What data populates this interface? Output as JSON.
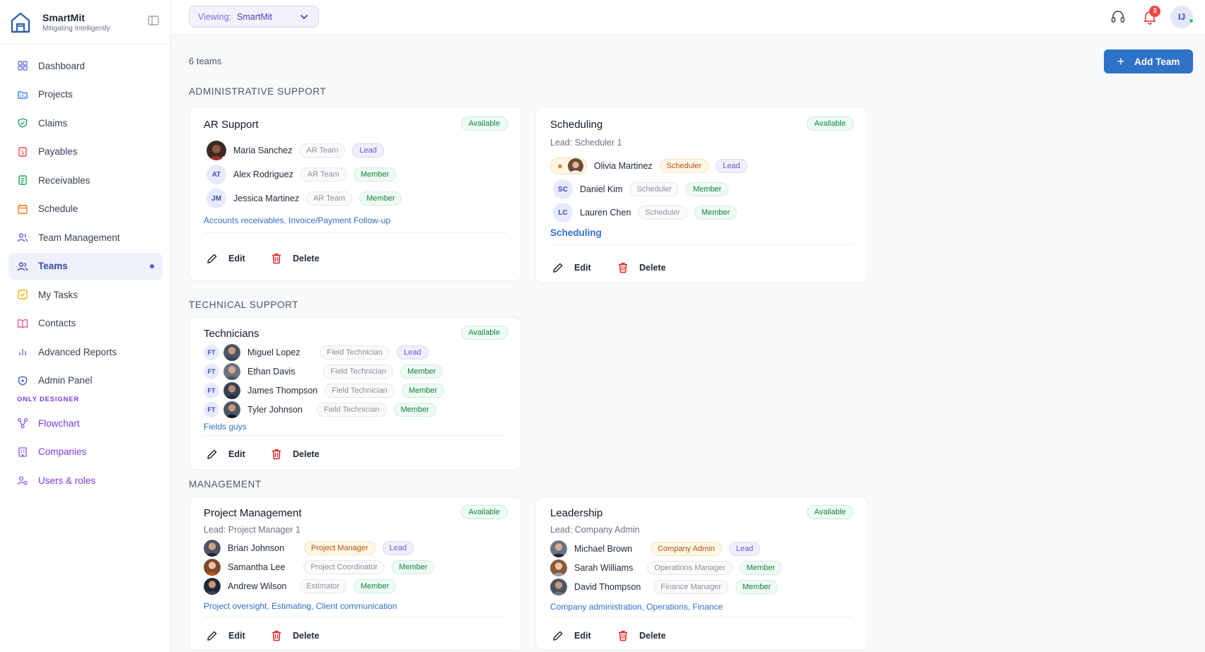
{
  "brand": {
    "name": "SmartMit",
    "tagline": "Mitigating Intelligently"
  },
  "sidebar": {
    "items": [
      {
        "label": "Dashboard",
        "icon": "grid-icon"
      },
      {
        "label": "Projects",
        "icon": "folder-icon"
      },
      {
        "label": "Claims",
        "icon": "shield-check-icon"
      },
      {
        "label": "Payables",
        "icon": "dollar-doc-icon"
      },
      {
        "label": "Receivables",
        "icon": "receipt-icon"
      },
      {
        "label": "Schedule",
        "icon": "calendar-icon"
      },
      {
        "label": "Team Management",
        "icon": "users-icon"
      },
      {
        "label": "Teams",
        "icon": "users-icon",
        "active": true
      },
      {
        "label": "My Tasks",
        "icon": "checkbox-icon"
      },
      {
        "label": "Contacts",
        "icon": "book-icon"
      },
      {
        "label": "Advanced Reports",
        "icon": "bar-chart-icon"
      },
      {
        "label": "Admin Panel",
        "icon": "shield-icon"
      }
    ],
    "designer_section": "ONLY DESIGNER",
    "designer_items": [
      {
        "label": "Flowchart",
        "icon": "flowchart-icon"
      },
      {
        "label": "Companies",
        "icon": "building-icon"
      },
      {
        "label": "Users & roles",
        "icon": "user-roles-icon"
      }
    ]
  },
  "topbar": {
    "viewing_label": "Viewing:",
    "viewing_value": "SmartMit",
    "notification_count": "3",
    "user_initials": "IJ"
  },
  "main": {
    "teams_count": "6 teams",
    "add_team_label": "Add Team",
    "edit_label": "Edit",
    "delete_label": "Delete",
    "sections": [
      {
        "title": "ADMINISTRATIVE SUPPORT",
        "cards": [
          {
            "name": "AR Support",
            "status": "Available",
            "lead": "",
            "members": [
              {
                "name": "Maria Sanchez",
                "role": "AR Team",
                "membership": "Lead",
                "avatar": "photo"
              },
              {
                "name": "Alex Rodriguez",
                "role": "AR Team",
                "membership": "Member",
                "avatar": "AT"
              },
              {
                "name": "Jessica Martinez",
                "role": "AR Team",
                "membership": "Member",
                "avatar": "JM"
              }
            ],
            "tags": "Accounts receivables, Invoice/Payment Follow-up"
          },
          {
            "name": "Scheduling",
            "status": "Available",
            "lead": "Lead: Scheduler 1",
            "members": [
              {
                "name": "Olivia Martinez",
                "role": "Scheduler",
                "membership": "Lead",
                "avatar": "photo"
              },
              {
                "name": "Daniel Kim",
                "role": "Scheduler",
                "membership": "Member",
                "avatar": "SC"
              },
              {
                "name": "Lauren Chen",
                "role": "Scheduler",
                "membership": "Member",
                "avatar": "LC"
              }
            ],
            "tags": "Scheduling"
          }
        ]
      },
      {
        "title": "TECHNICAL SUPPORT",
        "cards": [
          {
            "name": "Technicians",
            "status": "Available",
            "lead": "",
            "members": [
              {
                "name": "Miguel Lopez",
                "role": "Field Technician",
                "membership": "Lead",
                "avatar": "FT"
              },
              {
                "name": "Ethan Davis",
                "role": "Field Technician",
                "membership": "Member",
                "avatar": "FT"
              },
              {
                "name": "James Thompson",
                "role": "Field Technician",
                "membership": "Member",
                "avatar": "FT"
              },
              {
                "name": "Tyler Johnson",
                "role": "Field Technician",
                "membership": "Member",
                "avatar": "FT"
              }
            ],
            "tags": "Fields guys"
          }
        ]
      },
      {
        "title": "MANAGEMENT",
        "cards": [
          {
            "name": "Project Management",
            "status": "Available",
            "lead": "Lead: Project Manager 1",
            "members": [
              {
                "name": "Brian Johnson",
                "role": "Project Manager",
                "membership": "Lead",
                "avatar": "photo"
              },
              {
                "name": "Samantha Lee",
                "role": "Project Coordinator",
                "membership": "Member",
                "avatar": "photo"
              },
              {
                "name": "Andrew Wilson",
                "role": "Estimator",
                "membership": "Member",
                "avatar": "photo"
              }
            ],
            "tags": "Project oversight, Estimating, Client communication"
          },
          {
            "name": "Leadership",
            "status": "Available",
            "lead": "Lead: Company Admin",
            "members": [
              {
                "name": "Michael Brown",
                "role": "Company Admin",
                "membership": "Lead",
                "avatar": "photo"
              },
              {
                "name": "Sarah Williams",
                "role": "Operations Manager",
                "membership": "Member",
                "avatar": "photo"
              },
              {
                "name": "David Thompson",
                "role": "Finance Manager",
                "membership": "Member",
                "avatar": "photo"
              }
            ],
            "tags": "Company administration, Operations, Finance"
          }
        ]
      }
    ]
  },
  "colors": {
    "accent": "#2f73c9",
    "brand": "#3949ab",
    "available": "#15803d",
    "lead": "#6a5acd",
    "designer": "#7c3aed"
  }
}
